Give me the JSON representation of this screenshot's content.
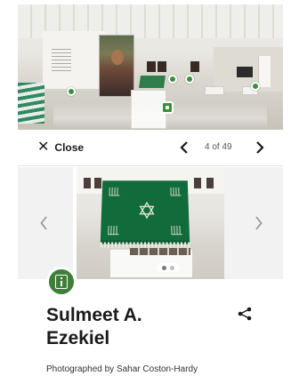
{
  "nav": {
    "close_label": "Close",
    "counter": "4 of 49"
  },
  "item": {
    "title_line1": "Sulmeet A.",
    "title_line2": "Ezekiel",
    "credit": "Photographed by Sahar Coston-Hardy"
  },
  "carousel": {
    "current_slide": 1,
    "total_slides": 2
  },
  "icons": {
    "close": "close-icon",
    "prev": "chevron-left-icon",
    "next": "chevron-right-icon",
    "share": "share-icon",
    "info": "info-icon"
  },
  "colors": {
    "accent": "#3d7f37",
    "text": "#1a1a1a",
    "muted": "#555555"
  }
}
